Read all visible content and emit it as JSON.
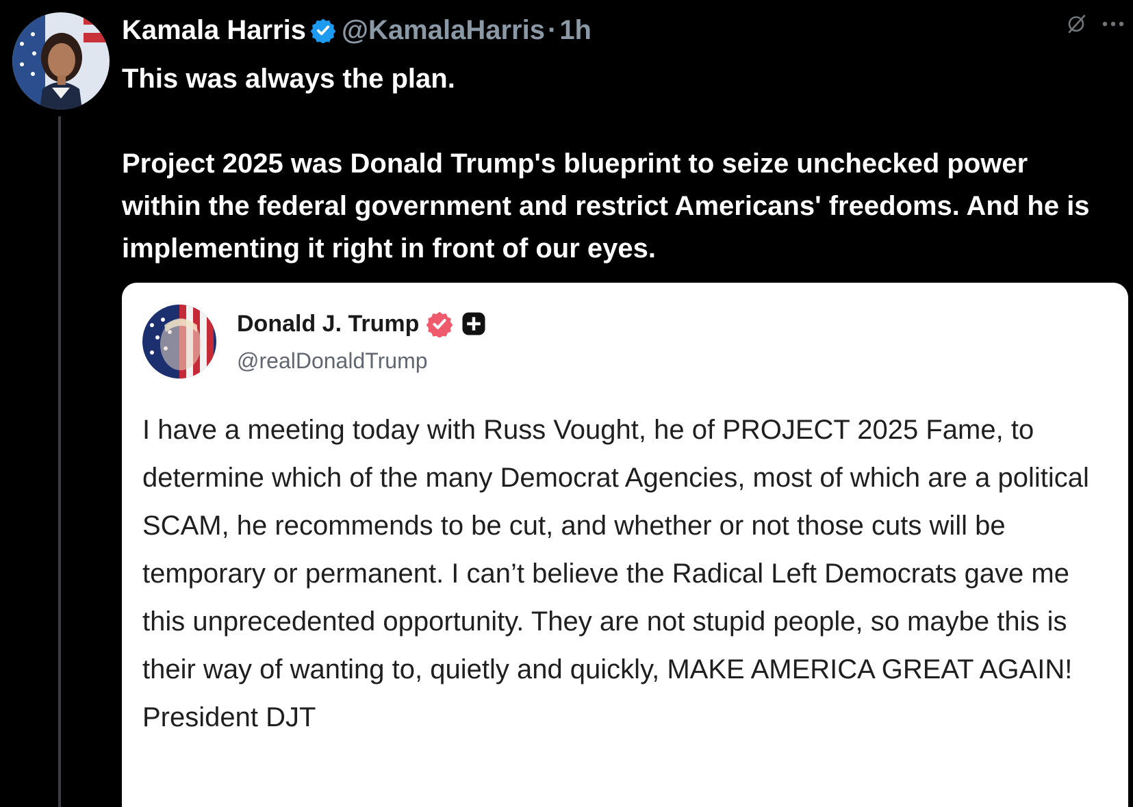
{
  "tweet": {
    "author_name": "Kamala Harris",
    "handle": "@KamalaHarris",
    "separator": "·",
    "time": "1h",
    "text": "This was always the plan.\n\nProject 2025 was Donald Trump's blueprint to seize unchecked power within the federal government and restrict Americans' freedoms. And he is implementing it right in front of our eyes."
  },
  "quote": {
    "author_name": "Donald J. Trump",
    "handle": "@realDonaldTrump",
    "text": "I have a meeting today with Russ Vought, he of PROJECT 2025 Fame,  to determine which of the many Democrat Agencies, most of which are a political SCAM, he recommends to be cut, and whether or not those cuts will be temporary or permanent. I can’t believe the Radical Left Democrats gave me this unprecedented opportunity. They are not stupid people, so maybe this is their way of wanting to, quietly and quickly, MAKE AMERICA GREAT AGAIN! President DJT"
  },
  "icons": {
    "verified": "verified-badge-icon",
    "grok": "grok-icon",
    "more": "more-icon",
    "quote_verified": "truth-verified-badge-icon",
    "quote_plus": "plus-badge-icon"
  },
  "colors": {
    "x_verified": "#1d9bf0",
    "truth_badge": "#ef5b6c",
    "background": "#000000",
    "muted": "#8b98a5"
  }
}
